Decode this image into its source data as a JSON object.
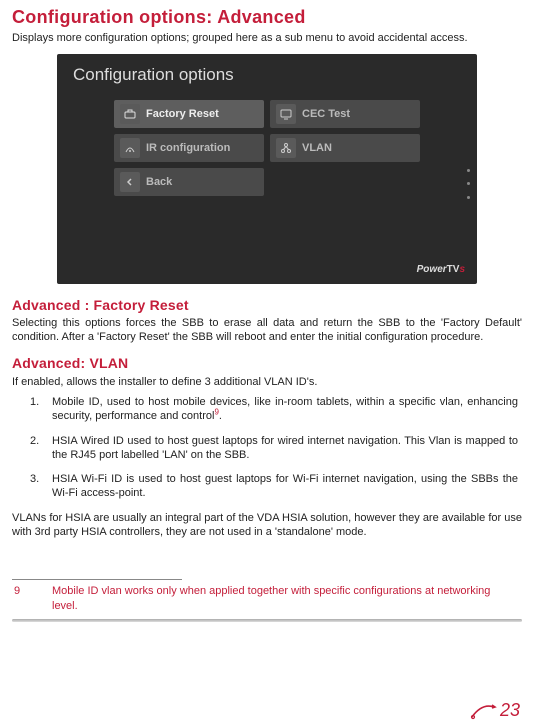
{
  "headings": {
    "main": "Configuration options: Advanced",
    "sub1": "Advanced : Factory Reset",
    "sub2": "Advanced: VLAN"
  },
  "intro": "Displays more configuration options; grouped here as a sub menu to avoid accidental access.",
  "screenshot": {
    "title": "Configuration options",
    "buttons": {
      "factory_reset": "Factory Reset",
      "cec_test": "CEC Test",
      "ir_config": "IR configuration",
      "vlan": "VLAN",
      "back": "Back"
    },
    "logo_power": "Power",
    "logo_tv": "TV",
    "logo_s": "s"
  },
  "factory_reset_body": "Selecting this options forces the SBB  to erase all data and return the SBB to the 'Factory Default' condition. After a 'Factory Reset' the SBB will reboot and enter the initial configuration procedure.",
  "vlan_intro": "If enabled, allows the installer to define 3 additional VLAN ID's.",
  "vlan_items": {
    "i1_n": "1.",
    "i1_pre": "Mobile ID, used to host mobile devices, like in-room tablets, within a specific vlan, enhancing security, performance and control",
    "i1_supref": "9",
    "i1_post": ".",
    "i2_n": "2.",
    "i2_t": "HSIA Wired ID used to host guest laptops for wired internet navigation. This Vlan is mapped to the RJ45 port labelled 'LAN' on the SBB.",
    "i3_n": "3.",
    "i3_t": "HSIA Wi-Fi ID is used to host guest laptops for Wi-Fi internet navigation, using the SBBs the Wi-Fi access-point."
  },
  "vlan_outro": "VLANs for HSIA are usually an integral part of the VDA HSIA solution, however they are available for use with 3rd party HSIA controllers, they are not used in a 'standalone' mode.",
  "footnote": {
    "n": "9",
    "t": "Mobile ID vlan works only when applied together with specific configurations at networking level."
  },
  "page_number": "23"
}
